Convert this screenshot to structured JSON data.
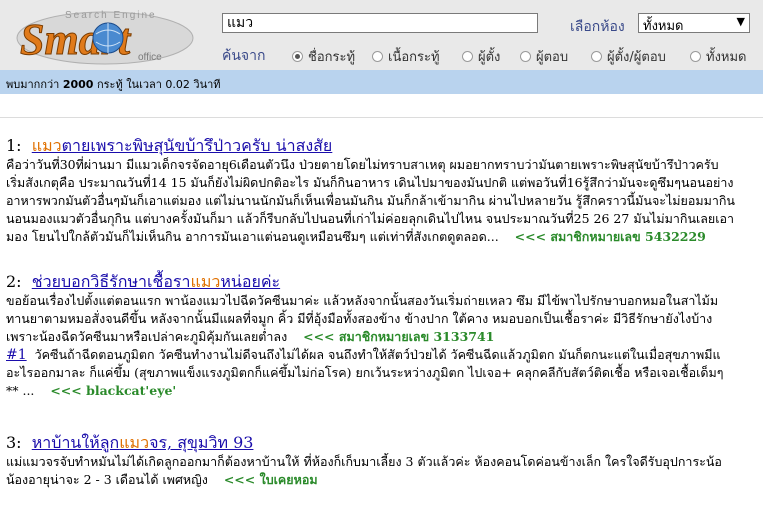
{
  "logo": {
    "brand": "Smart",
    "top": "Search Engine",
    "sub": "office"
  },
  "search": {
    "value": "แมว"
  },
  "room": {
    "label": "เลือกห้อง",
    "value": "ทั้งหมด"
  },
  "searchin": {
    "label": "ค้นจาก",
    "options": [
      {
        "label": "ชื่อกระทู้",
        "checked": true
      },
      {
        "label": "เนื้อกระทู้",
        "checked": false
      },
      {
        "label": "ผู้ตั้ง",
        "checked": false
      },
      {
        "label": "ผู้ตอบ",
        "checked": false
      },
      {
        "label": "ผู้ตั้ง/ผู้ตอบ",
        "checked": false
      },
      {
        "label": "ทั้งหมด",
        "checked": false
      }
    ]
  },
  "status": {
    "pre": "พบมากกว่า ",
    "count": "2000",
    "post": " กระทู้ ในเวลา 0.02 วินาที"
  },
  "results": [
    {
      "num": "1:",
      "title_hl": "แมว",
      "title_rest": "ตายเพราะพิษสุนัขบ้ารึป่าวครับ น่าสงสัย",
      "lines": [
        "คือว่าวันที่30ที่ผ่านมา มีแมวเด็กจรจัดอายุ6เดือนตัวนึง ป่วยตายโดยไม่ทราบสาเหตุ ผมอยากทราบว่ามันตายเพราะพิษสุนัขบ้ารึป่าวครับ",
        "เริ่มสังเกตุคือ ประมาณวันที่14 15 มันก็ยังไม่ผิดปกติอะไร มันก็กินอาหาร เดินไปมาของมันปกติ แต่พอวันที่16รู้สึกว่ามันจะดูซึมๆนอนอย่าง",
        "อาหารพวกมันตัวอื่นๆมันก็เอาแต่มอง แต่ไม่นานนักมันก็เห็นเพื่อนมันกิน มันก็กล้าเข้ามากิน ผ่านไปหลายวัน รู้สึกคราวนี้มันจะไม่ยอมมากิน",
        "นอนมองแมวตัวอื่นกุกิน แต่บางครั้งมันก็มา แล้วก็รีบกลับไปนอนที่เก่าไม่ค่อยลุกเดินไปไหน จนประมาณวันที่25 26 27 มันไม่มากินเลยเอา"
      ],
      "last_line": "มอง โยนไปใกล้ตัวมันก็ไม่เห็นกิน อาการมันเอาแต่นอนดูเหมือนซึมๆ แต่เท่าที่สังเกตดูตลอด...",
      "member": "<<< สมาชิกหมายเลข 5432229"
    },
    {
      "num": "2:",
      "title_pre": "ช่วยบอกวิธีรักษาเชื้อรา",
      "title_hl": "แมว",
      "title_rest": "หน่อยค่ะ",
      "lines": [
        "ขอย้อนเรื่องไปตั้งแต่ตอนแรก พาน้องแมวไปฉีดวัคซีนมาค่ะ แล้วหลังจากนั้นสองวันเริ่มถ่ายเหลว ซึม มีไข้พาไปรักษาบอกหมอในสาไม้ม",
        "ทานยาตามหมอสั่งจนดีขึ้น หลังจากนั้นมีแผลที่จมูก คิ้ว มีที่อุ้งมือทั้งสองข้าง ข้างปาก ใต้คาง หมอบอกเป็นเชื้อราค่ะ มีวิธีรักษายังไงบ้าง"
      ],
      "last_line": "เพราะน้องฉีดวัคซีนมาหรือเปล่าคะภูมิคุ้มกันเลยต่ำลง",
      "member": "<<< สมาชิกหมายเลข 3133741",
      "reply": {
        "num": "#1",
        "lines": [
          "วัคซีนถ้าฉีดตอนภูมิตก วัคซีนทำงานไม่ดีจนถึงไม่ได้ผล จนถึงทำให้สัตว์ป่วยได้ วัคซีนฉีดแล้วภูมิตก มันก็ตกนะแต่ในเมื่อสุขภาพมีแ",
          "อะไรออกมาละ ก็แค่ขึ้ม (สุขภาพแข็งแรงภูมิตกก็แค่ขึ้มไม่ก่อโรค) ยกเว้นระหว่างภูมิตก ไปเจอ+ คลุกคลีกับสัตว์ติดเชื้อ หรือเจอเชื้อเด็มๆ"
        ],
        "last_line": "** ...",
        "member": "<<< blackcat'eye'"
      }
    },
    {
      "num": "3:",
      "title_pre": "หาบ้านให้ลูก",
      "title_hl": "แมว",
      "title_rest": "จร, สุขุมวิท 93",
      "lines": [
        "แม่แมวจรจับทำหมันไม่ได้เกิดลูกออกมาก็ต้องหาบ้านให้ ที่ห้องก็เก็บมาเลี้ยง 3 ตัวแล้วค่ะ ห้องคอนโดค่อนข้างเล็ก ใครใจดีรับอุปการะน้อ"
      ],
      "last_line": "น้องอายุน่าจะ 2 - 3 เดือนได้ เพศหญิง",
      "member": "<<< ใบเคยหอม"
    }
  ]
}
